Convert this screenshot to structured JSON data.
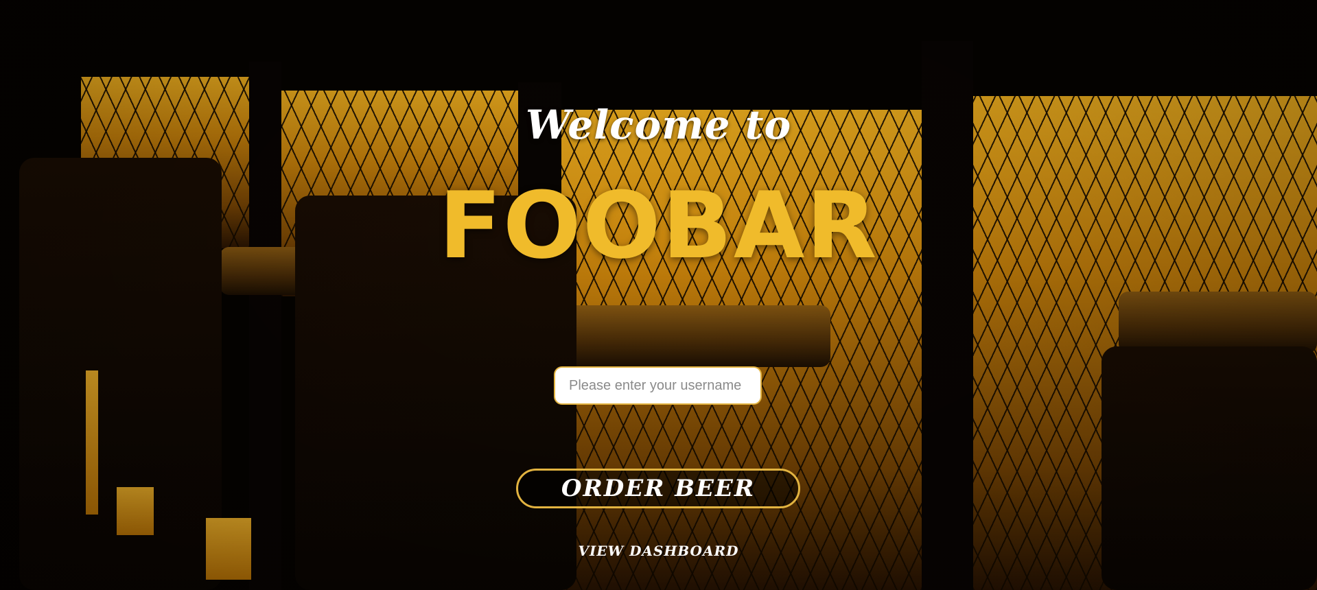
{
  "hero": {
    "welcome_text": "Welcome to",
    "brand_name": "FOOBAR"
  },
  "form": {
    "username_placeholder": "Please enter your username",
    "username_value": "",
    "order_button_label": "ORDER BEER",
    "dashboard_link_label": "VIEW DASHBOARD"
  },
  "colors": {
    "accent": "#f0bb2b",
    "button_border": "#e2b340",
    "text_light": "#ffffff"
  }
}
